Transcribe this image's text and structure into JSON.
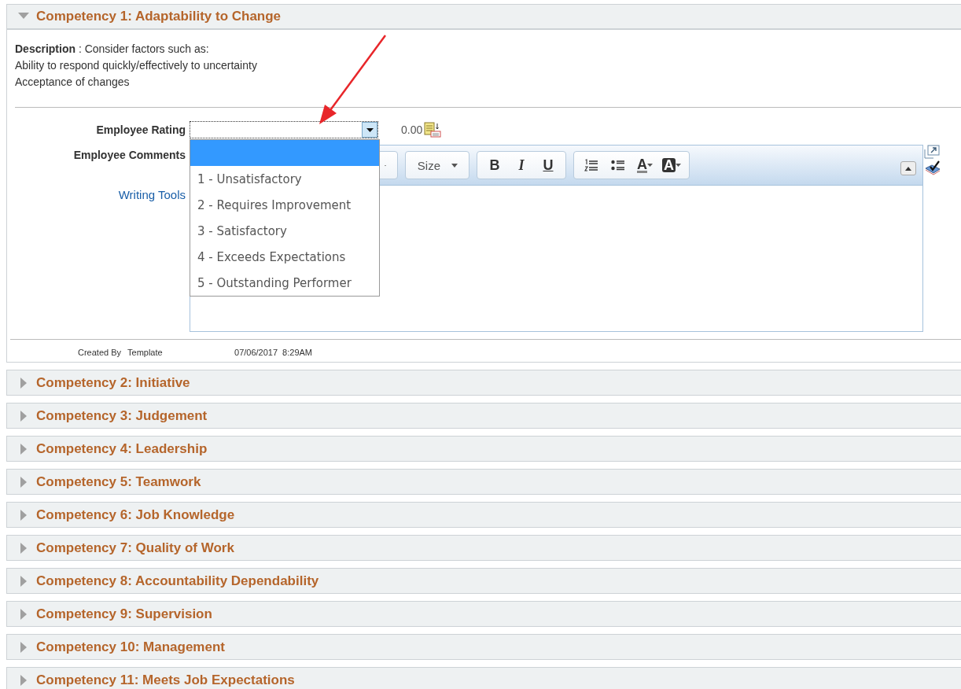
{
  "sections": [
    {
      "title": "Competency 1: Adaptability to Change",
      "expanded": true,
      "description": [
        "**Description** : Consider factors such as:",
        "Ability to respond quickly/effectively to uncertainty",
        "Acceptance of changes"
      ],
      "rating": {
        "label": "Employee Rating",
        "score": "0.00",
        "open": true,
        "options": [
          {
            "selected": true
          },
          {
            "label": "1 - Unsatisfactory",
            "selected": false
          },
          {
            "label": "2 - Requires Improvement",
            "selected": false
          },
          {
            "label": "3 - Satisfactory",
            "selected": false
          },
          {
            "label": "4 - Exceeds Expectations",
            "selected": false
          },
          {
            "label": "5 - Outstanding Performer",
            "selected": false
          }
        ]
      },
      "comments": {
        "label": "Employee Comments",
        "link": "Writing Tools",
        "toolbar": [
          {
            "items": [
              {
                "kind": "combo"
              }
            ]
          },
          {
            "items": [
              {
                "kind": "combo",
                "label": "Size"
              }
            ]
          },
          {
            "items": [
              {
                "kind": "bold",
                "label": "B"
              },
              {
                "kind": "italic",
                "label": "I"
              },
              {
                "kind": "underline",
                "label": "U"
              }
            ]
          },
          {
            "items": [
              {
                "kind": "numbered-list"
              },
              {
                "kind": "bullet-list"
              },
              {
                "kind": "text-color",
                "label": "A"
              },
              {
                "kind": "highlight-color",
                "label": "A"
              }
            ]
          }
        ]
      },
      "footer": {
        "label": "Created By",
        "value": "Template",
        "date": "07/06/2017",
        "time": "8:29AM"
      }
    },
    {
      "title": "Competency 2: Initiative",
      "expanded": false
    },
    {
      "title": "Competency 3: Judgement",
      "expanded": false
    },
    {
      "title": "Competency 4: Leadership",
      "expanded": false
    },
    {
      "title": "Competency 5: Teamwork",
      "expanded": false
    },
    {
      "title": "Competency 6: Job Knowledge",
      "expanded": false
    },
    {
      "title": "Competency 7: Quality of Work",
      "expanded": false
    },
    {
      "title": "Competency 8: Accountability Dependability",
      "expanded": false
    },
    {
      "title": "Competency 9: Supervision",
      "expanded": false
    },
    {
      "title": "Competency 10: Management",
      "expanded": false
    },
    {
      "title": "Competency 11: Meets Job Expectations",
      "expanded": false
    }
  ]
}
